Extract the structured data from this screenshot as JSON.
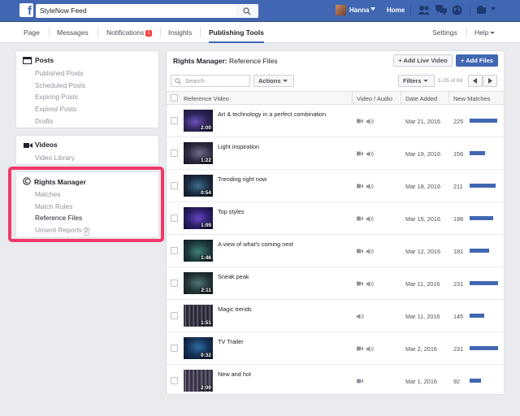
{
  "topbar": {
    "logo": "f",
    "search_value": "StyleNow Feed",
    "user_name": "Hanna",
    "home_label": "Home"
  },
  "page_nav": {
    "tabs": [
      "Page",
      "Messages",
      "Notifications",
      "Insights",
      "Publishing Tools"
    ],
    "notifications_badge": "1",
    "active_tab": "Publishing Tools",
    "settings_label": "Settings",
    "help_label": "Help"
  },
  "sidebar": {
    "posts": {
      "title": "Posts",
      "items": [
        "Published Posts",
        "Scheduled Posts",
        "Expiring Posts",
        "Expired Posts",
        "Drafts"
      ]
    },
    "videos": {
      "title": "Videos",
      "items": [
        "Video Library"
      ]
    },
    "rights_manager": {
      "title": "Rights Manager",
      "items": [
        "Matches",
        "Match Rules",
        "Reference Files",
        "Unsent Reports"
      ],
      "current_item": "Reference Files",
      "unsent_count": "2"
    }
  },
  "main": {
    "title_bold": "Rights Manager:",
    "title_rest": " Reference Files",
    "add_live_label": "+ Add Live Video",
    "add_files_label": "+ Add Files",
    "search_placeholder": "Search",
    "actions_label": "Actions",
    "filters_label": "Filters",
    "pager": "1-25 of 68",
    "columns": [
      "Reference Video",
      "Video / Audio",
      "Date Added",
      "New Matches"
    ],
    "rows": [
      {
        "title": "Art & technology in a perfect combination",
        "duration": "2:00",
        "date": "Mar 21, 2016",
        "matches": "225",
        "level": 0.97,
        "video": true,
        "audio": true
      },
      {
        "title": "Light inspiration",
        "duration": "1:22",
        "date": "Mar 19, 2016",
        "matches": "156",
        "level": 0.55,
        "video": true,
        "audio": true
      },
      {
        "title": "Trending right now",
        "duration": "0:54",
        "date": "Mar 18, 2016",
        "matches": "211",
        "level": 0.9,
        "video": true,
        "audio": true
      },
      {
        "title": "Top styles",
        "duration": "1:09",
        "date": "Mar 15, 2016",
        "matches": "198",
        "level": 0.82,
        "video": true,
        "audio": true
      },
      {
        "title": "A view of what's coming next",
        "duration": "1:46",
        "date": "Mar 12, 2016",
        "matches": "181",
        "level": 0.68,
        "video": true,
        "audio": true
      },
      {
        "title": "Sneak peak",
        "duration": "2:11",
        "date": "Mar 11, 2016",
        "matches": "231",
        "level": 1.0,
        "video": true,
        "audio": true
      },
      {
        "title": "Magic trends",
        "duration": "1:51",
        "date": "Mar 11, 2016",
        "matches": "145",
        "level": 0.5,
        "video": false,
        "audio": true
      },
      {
        "title": "TV Trailer",
        "duration": "0:32",
        "date": "Mar 2, 2016",
        "matches": "231",
        "level": 1.0,
        "video": true,
        "audio": true
      },
      {
        "title": "New and hot",
        "duration": "2:00",
        "date": "Mar 1, 2016",
        "matches": "92",
        "level": 0.4,
        "video": true,
        "audio": false
      }
    ]
  },
  "colors": {
    "brand": "#4267b2",
    "highlight": "#f0386b",
    "bar": "#4267b2"
  }
}
